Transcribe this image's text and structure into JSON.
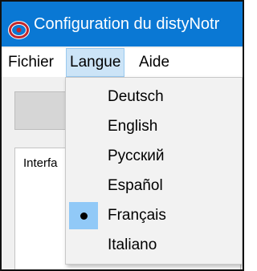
{
  "window": {
    "title": "Configuration du distyNotr"
  },
  "menubar": {
    "items": [
      {
        "label": "Fichier"
      },
      {
        "label": "Langue"
      },
      {
        "label": "Aide"
      }
    ]
  },
  "panel": {
    "tab_label": "Interfa"
  },
  "language_menu": {
    "items": [
      {
        "label": "Deutsch",
        "selected": false
      },
      {
        "label": "English",
        "selected": false
      },
      {
        "label": "Русский",
        "selected": false
      },
      {
        "label": "Español",
        "selected": false
      },
      {
        "label": "Français",
        "selected": true
      },
      {
        "label": "Italiano",
        "selected": false
      }
    ]
  },
  "colors": {
    "titlebar": "#0a78d4",
    "menu_highlight": "#cce4f7",
    "selected_check_bg": "#91c9f7",
    "app_icon": "#c0282d"
  },
  "icons": {
    "app": "app-logo-icon",
    "selected": "radio-bullet-icon"
  }
}
